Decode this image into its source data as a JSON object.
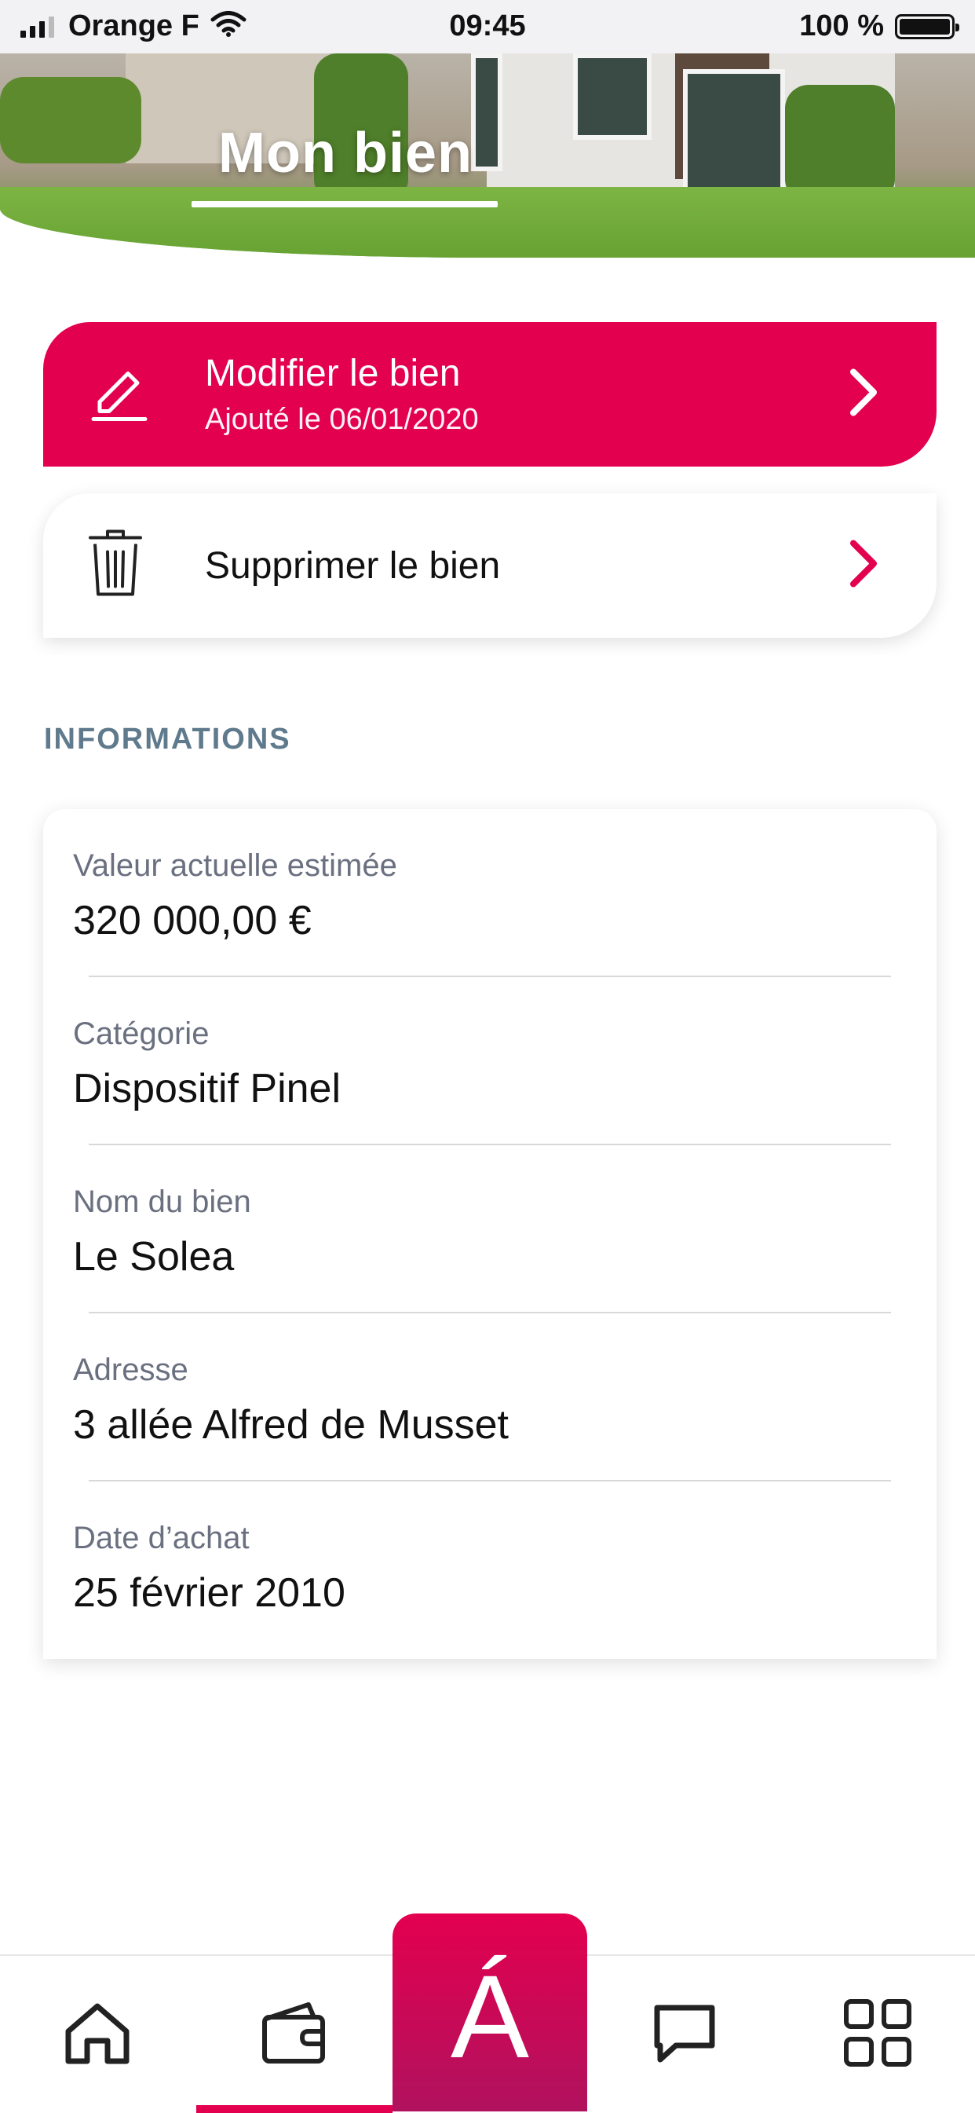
{
  "status_bar": {
    "carrier": "Orange F",
    "time": "09:45",
    "battery": "100 %"
  },
  "header": {
    "title": "Mon bien"
  },
  "actions": {
    "edit": {
      "title": "Modifier le bien",
      "subtitle": "Ajouté le 06/01/2020",
      "icon": "pencil-icon"
    },
    "delete": {
      "title": "Supprimer le bien",
      "icon": "trash-icon"
    }
  },
  "informations": {
    "title": "INFORMATIONS",
    "rows": [
      {
        "label": "Valeur actuelle estimée",
        "value": "320 000,00 €"
      },
      {
        "label": "Catégorie",
        "value": "Dispositif Pinel"
      },
      {
        "label": "Nom du bien",
        "value": "Le Solea"
      },
      {
        "label": "Adresse",
        "value": "3 allée Alfred de Musset"
      },
      {
        "label": "Date d’achat",
        "value": "25 février 2010"
      }
    ]
  },
  "bottom_nav": {
    "items": [
      {
        "icon": "home-icon",
        "active": false
      },
      {
        "icon": "wallet-icon",
        "active": true
      },
      {
        "icon": "brand-a-logo",
        "active": false
      },
      {
        "icon": "chat-icon",
        "active": false
      },
      {
        "icon": "grid-icon",
        "active": false
      }
    ],
    "center_logo": "Á"
  },
  "colors": {
    "accent": "#e3004f",
    "section_title": "#5f7a8c",
    "label": "#6a7080"
  }
}
